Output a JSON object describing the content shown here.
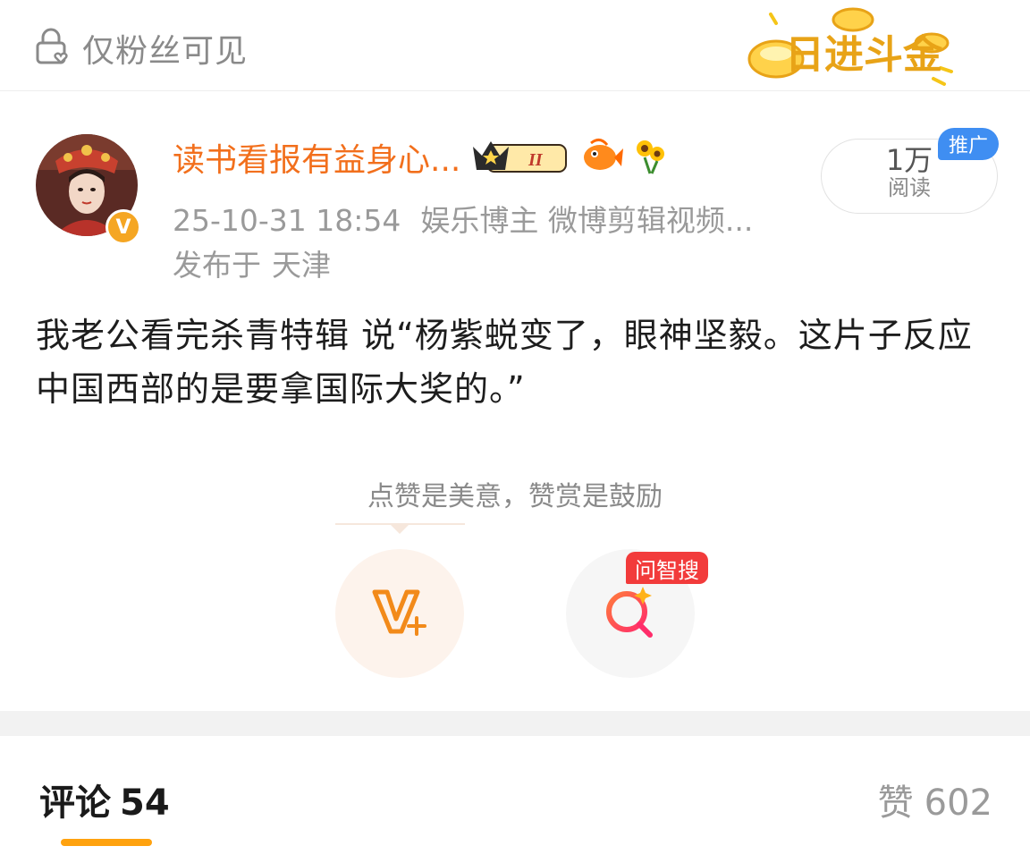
{
  "topbar": {
    "visibility_label": "仅粉丝可见",
    "banner_text": "日进斗金"
  },
  "post": {
    "author_name": "读书看报有益身心...",
    "timestamp": "25-10-31 18:54",
    "author_tags": "娱乐博主 微博剪辑视频...",
    "location_prefix": "发布于",
    "location": "天津",
    "reads_count": "1万",
    "reads_label": "阅读",
    "promo_badge": "推广",
    "content": "我老公看完杀青特辑 说“杨紫蜕变了，眼神坚毅。这片子反应中国西部的是要拿国际大奖的。”"
  },
  "reward": {
    "hint": "点赞是美意，赞赏是鼓励",
    "search_tag": "问智搜"
  },
  "tabs": {
    "comments_label": "评论",
    "comments_count": "54",
    "likes_label": "赞",
    "likes_count": "602"
  },
  "colors": {
    "accent_orange": "#f26f1c",
    "underline": "#ffa20f",
    "promo_blue": "#3f8ef2",
    "search_red": "#f23b3b",
    "verified_gold": "#f5a623"
  }
}
